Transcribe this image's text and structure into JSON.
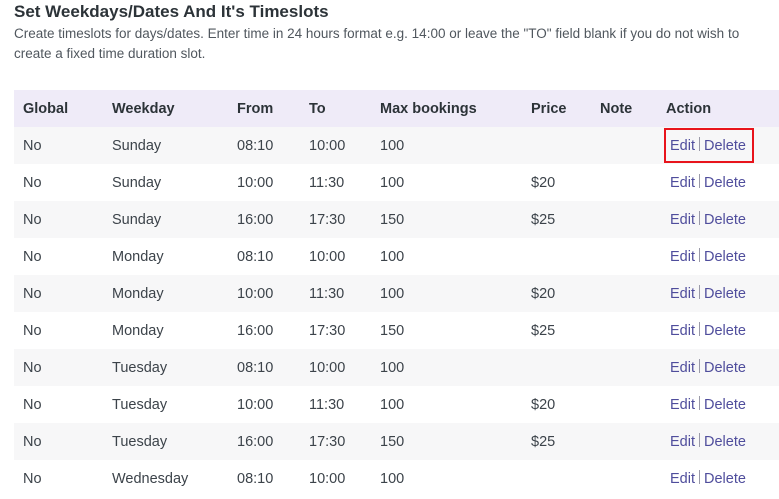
{
  "header": {
    "title": "Set Weekdays/Dates And It's Timeslots",
    "description": "Create timeslots for days/dates. Enter time in 24 hours format e.g. 14:00 or leave the \"TO\" field blank if you do not wish to create a fixed time duration slot."
  },
  "table": {
    "columns": {
      "global": "Global",
      "weekday": "Weekday",
      "from": "From",
      "to": "To",
      "max": "Max bookings",
      "price": "Price",
      "note": "Note",
      "action": "Action"
    },
    "edit_label": "Edit",
    "delete_label": "Delete",
    "highlight_color": "#e8141c",
    "rows": [
      {
        "global": "No",
        "weekday": "Sunday",
        "from": "08:10",
        "to": "10:00",
        "max": "100",
        "price": "",
        "note": "",
        "highlighted": true
      },
      {
        "global": "No",
        "weekday": "Sunday",
        "from": "10:00",
        "to": "11:30",
        "max": "100",
        "price": "$20",
        "note": ""
      },
      {
        "global": "No",
        "weekday": "Sunday",
        "from": "16:00",
        "to": "17:30",
        "max": "150",
        "price": "$25",
        "note": ""
      },
      {
        "global": "No",
        "weekday": "Monday",
        "from": "08:10",
        "to": "10:00",
        "max": "100",
        "price": "",
        "note": ""
      },
      {
        "global": "No",
        "weekday": "Monday",
        "from": "10:00",
        "to": "11:30",
        "max": "100",
        "price": "$20",
        "note": ""
      },
      {
        "global": "No",
        "weekday": "Monday",
        "from": "16:00",
        "to": "17:30",
        "max": "150",
        "price": "$25",
        "note": ""
      },
      {
        "global": "No",
        "weekday": "Tuesday",
        "from": "08:10",
        "to": "10:00",
        "max": "100",
        "price": "",
        "note": ""
      },
      {
        "global": "No",
        "weekday": "Tuesday",
        "from": "10:00",
        "to": "11:30",
        "max": "100",
        "price": "$20",
        "note": ""
      },
      {
        "global": "No",
        "weekday": "Tuesday",
        "from": "16:00",
        "to": "17:30",
        "max": "150",
        "price": "$25",
        "note": ""
      },
      {
        "global": "No",
        "weekday": "Wednesday",
        "from": "08:10",
        "to": "10:00",
        "max": "100",
        "price": "",
        "note": ""
      }
    ]
  }
}
